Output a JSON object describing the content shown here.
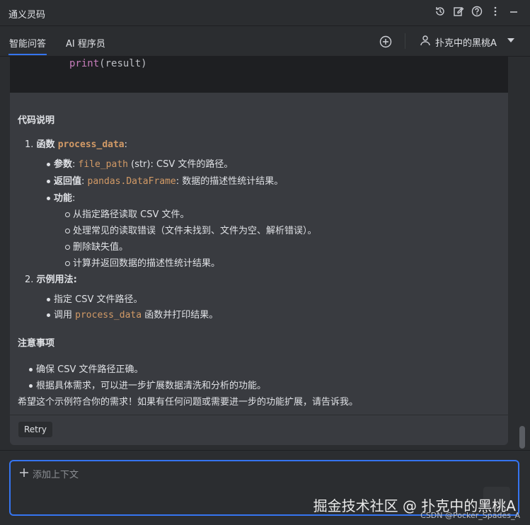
{
  "window": {
    "title": "通义灵码"
  },
  "tabs": [
    {
      "label": "智能问答",
      "active": true
    },
    {
      "label": "AI 程序员",
      "active": false
    }
  ],
  "user": {
    "name": "扑克中的黑桃A"
  },
  "code": {
    "fn": "print",
    "args": "(result)"
  },
  "answer": {
    "heading1": "代码说明",
    "item1": {
      "num": "1.",
      "label": "函数",
      "code": "process_data",
      "tail": ":"
    },
    "params_label": "参数",
    "params_code": "file_path",
    "params_text": " (str): CSV 文件的路径。",
    "return_label": "返回值",
    "return_code": "pandas.DataFrame",
    "return_text": ": 数据的描述性统计结果。",
    "func_label": "功能",
    "func_items": [
      "从指定路径读取 CSV 文件。",
      "处理常见的读取错误（文件未找到、文件为空、解析错误）。",
      "删除缺失值。",
      "计算并返回数据的描述性统计结果。"
    ],
    "item2": {
      "num": "2.",
      "label": "示例用法"
    },
    "usage1": "指定 CSV 文件路径。",
    "usage2_pre": "调用 ",
    "usage2_code": "process_data",
    "usage2_post": " 函数并打印结果。",
    "heading2": "注意事项",
    "notes": [
      "确保 CSV 文件路径正确。",
      "根据具体需求，可以进一步扩展数据清洗和分析的功能。"
    ],
    "closing": "希望这个示例符合你的需求！如果有任何问题或需要进一步的功能扩展，请告诉我。",
    "retry": "Retry"
  },
  "input": {
    "placeholder": "添加上下文"
  },
  "watermark": {
    "main": "掘金技术社区 @ 扑克中的黑桃A",
    "sub": "CSDN @Pocker_Spades_A"
  },
  "icons": [
    "history-icon",
    "edit-icon",
    "help-icon",
    "more-icon",
    "add-icon",
    "user-icon",
    "dropdown-icon",
    "plus-icon"
  ],
  "colors": {
    "accent": "#3574f0",
    "code": "#d29a66",
    "bg": "#2b2d30"
  }
}
